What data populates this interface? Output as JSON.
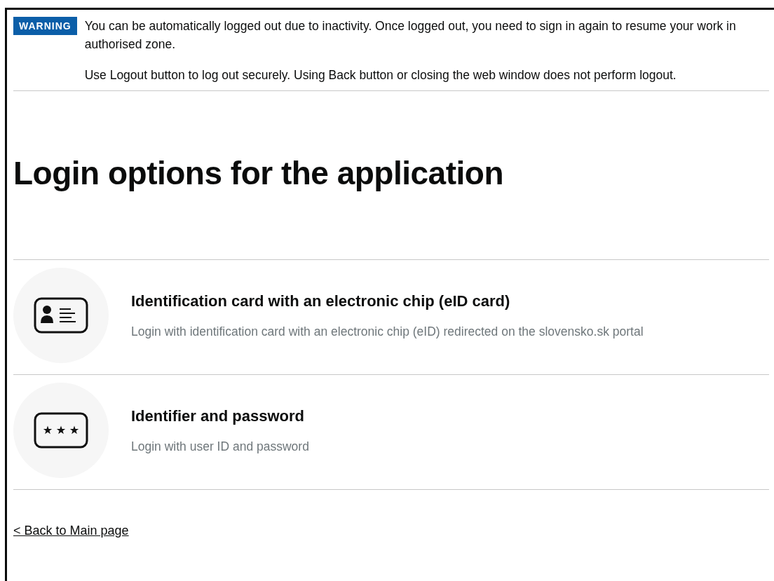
{
  "warning": {
    "badge": "WARNING",
    "paragraphs": [
      "You can be automatically logged out due to inactivity. Once logged out, you need to sign in again to resume your work in authorised zone.",
      "Use Logout button to log out securely. Using Back button or closing the web window does not perform logout."
    ]
  },
  "heading": "Login options for the application",
  "options": [
    {
      "kind": "id-card",
      "title": "Identification card with an electronic chip (eID card)",
      "description": "Login with identification card with an electronic chip (eID) redirected on the slovensko.sk portal"
    },
    {
      "kind": "password",
      "title": "Identifier and password",
      "description": "Login with user ID and password"
    }
  ],
  "back_link": "< Back to Main page"
}
